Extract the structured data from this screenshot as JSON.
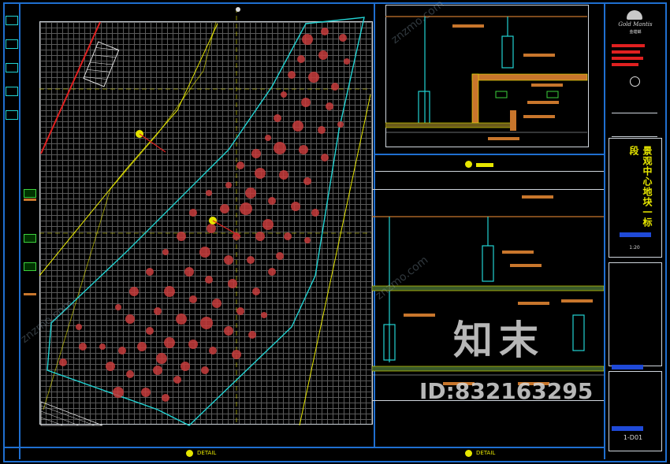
{
  "watermark": {
    "brand_cn": "知末",
    "id_text": "ID:832163295",
    "site_text": "znzmo.com"
  },
  "title_block": {
    "logo_text": "Gold Mantis",
    "logo_sub": "金螳螂",
    "project_title": "景观中心地块一标段",
    "drawing_no": "1-D01",
    "scale_label": "1:20"
  },
  "detail_labels": {
    "main_plan": "DETAIL",
    "section_a": "DETAIL",
    "section_b": "DETAIL"
  },
  "colors": {
    "frame": "#1f6fd0",
    "grid": "#5a5a5a",
    "cyan_outline": "#22d3d3",
    "yellow_lines": "#e6e600",
    "dots": "#c83c3c",
    "annotations": "#c8762c",
    "red_text": "#e02020"
  }
}
